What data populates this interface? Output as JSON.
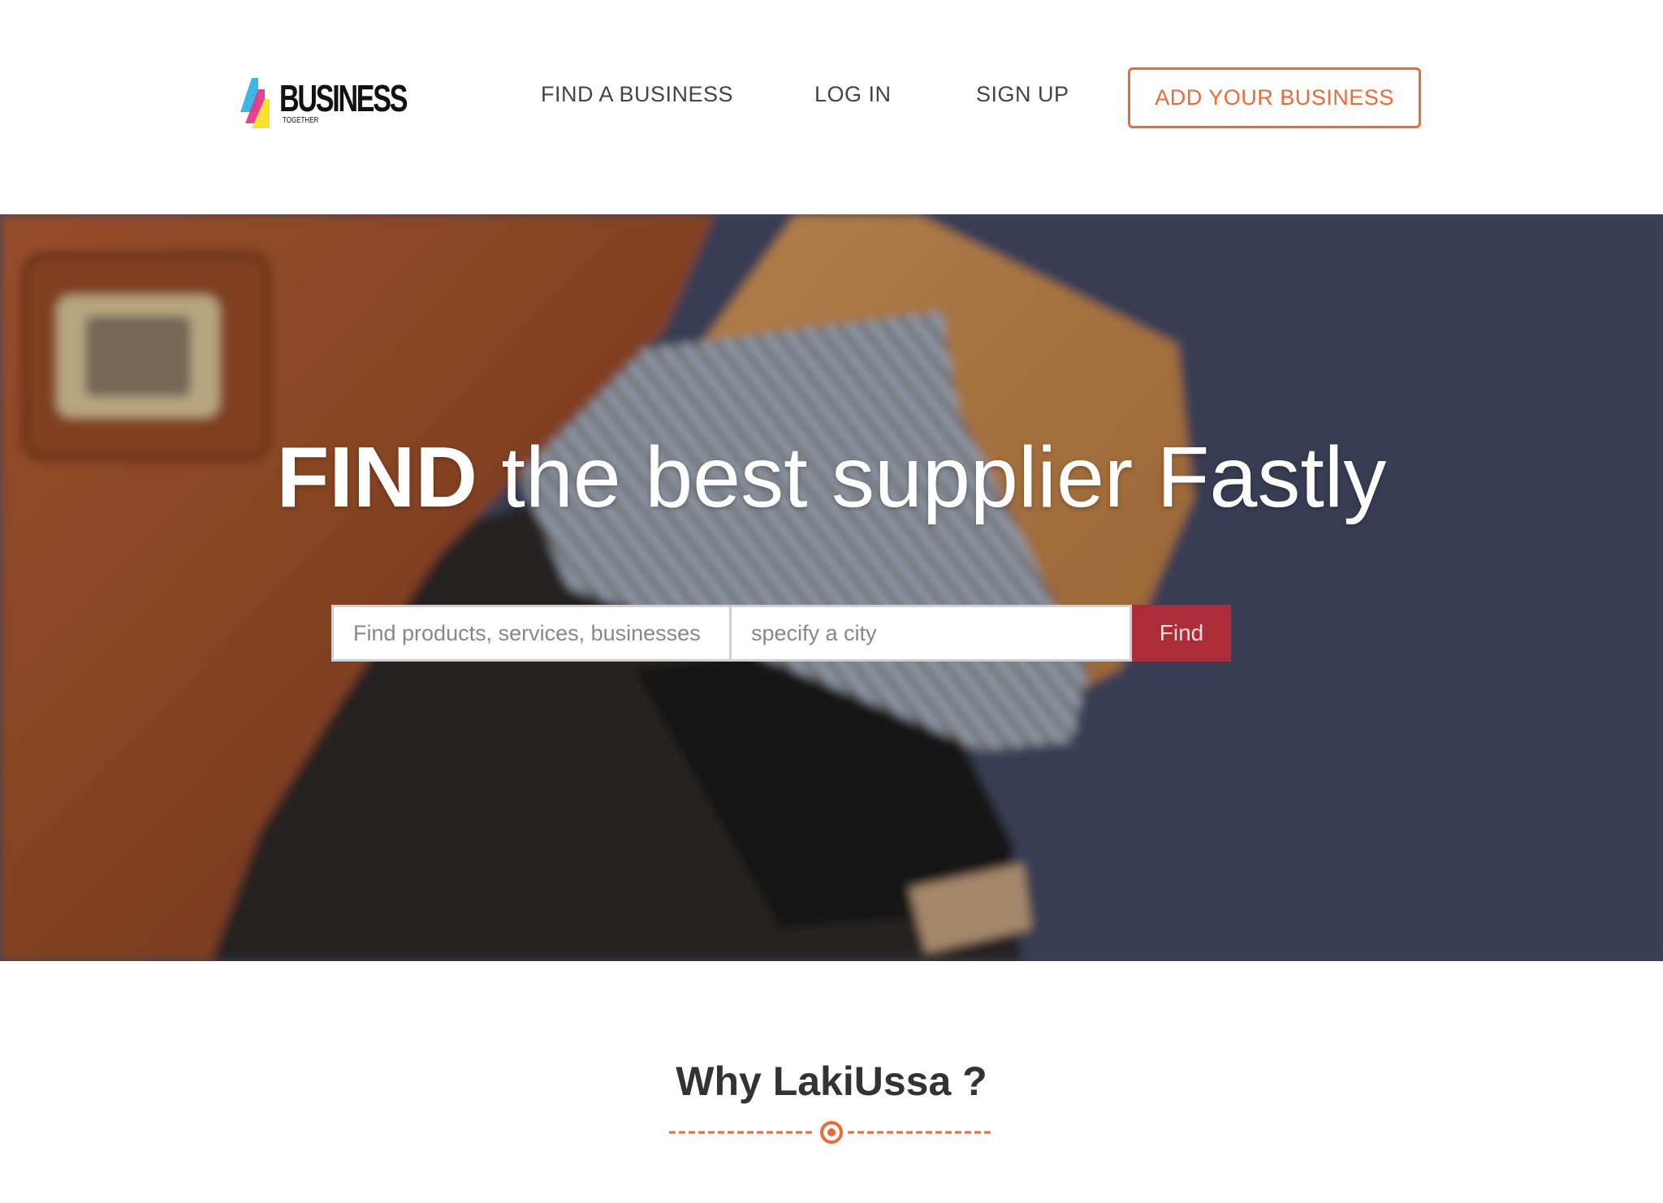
{
  "brand": {
    "name": "BUSINESS",
    "tagline": "TOGETHER",
    "colors": {
      "accent": "#ec6a36",
      "find_button": "#ad2c3a",
      "triangle_cyan": "#3bb6e6",
      "triangle_magenta": "#e6398a",
      "triangle_yellow": "#f6e32f"
    }
  },
  "nav": {
    "find_business": "FIND A BUSINESS",
    "login": "LOG IN",
    "signup": "SIGN UP",
    "add_business": "ADD YOUR BUSINESS"
  },
  "hero": {
    "title_strong": "FIND",
    "title_rest": " the best supplier Fastly",
    "search": {
      "what_placeholder": "Find products, services, businesses",
      "where_placeholder": "specify a city",
      "button_label": "Find"
    }
  },
  "why": {
    "title": "Why LakiUssa ?",
    "divider_icon": "target-icon"
  }
}
